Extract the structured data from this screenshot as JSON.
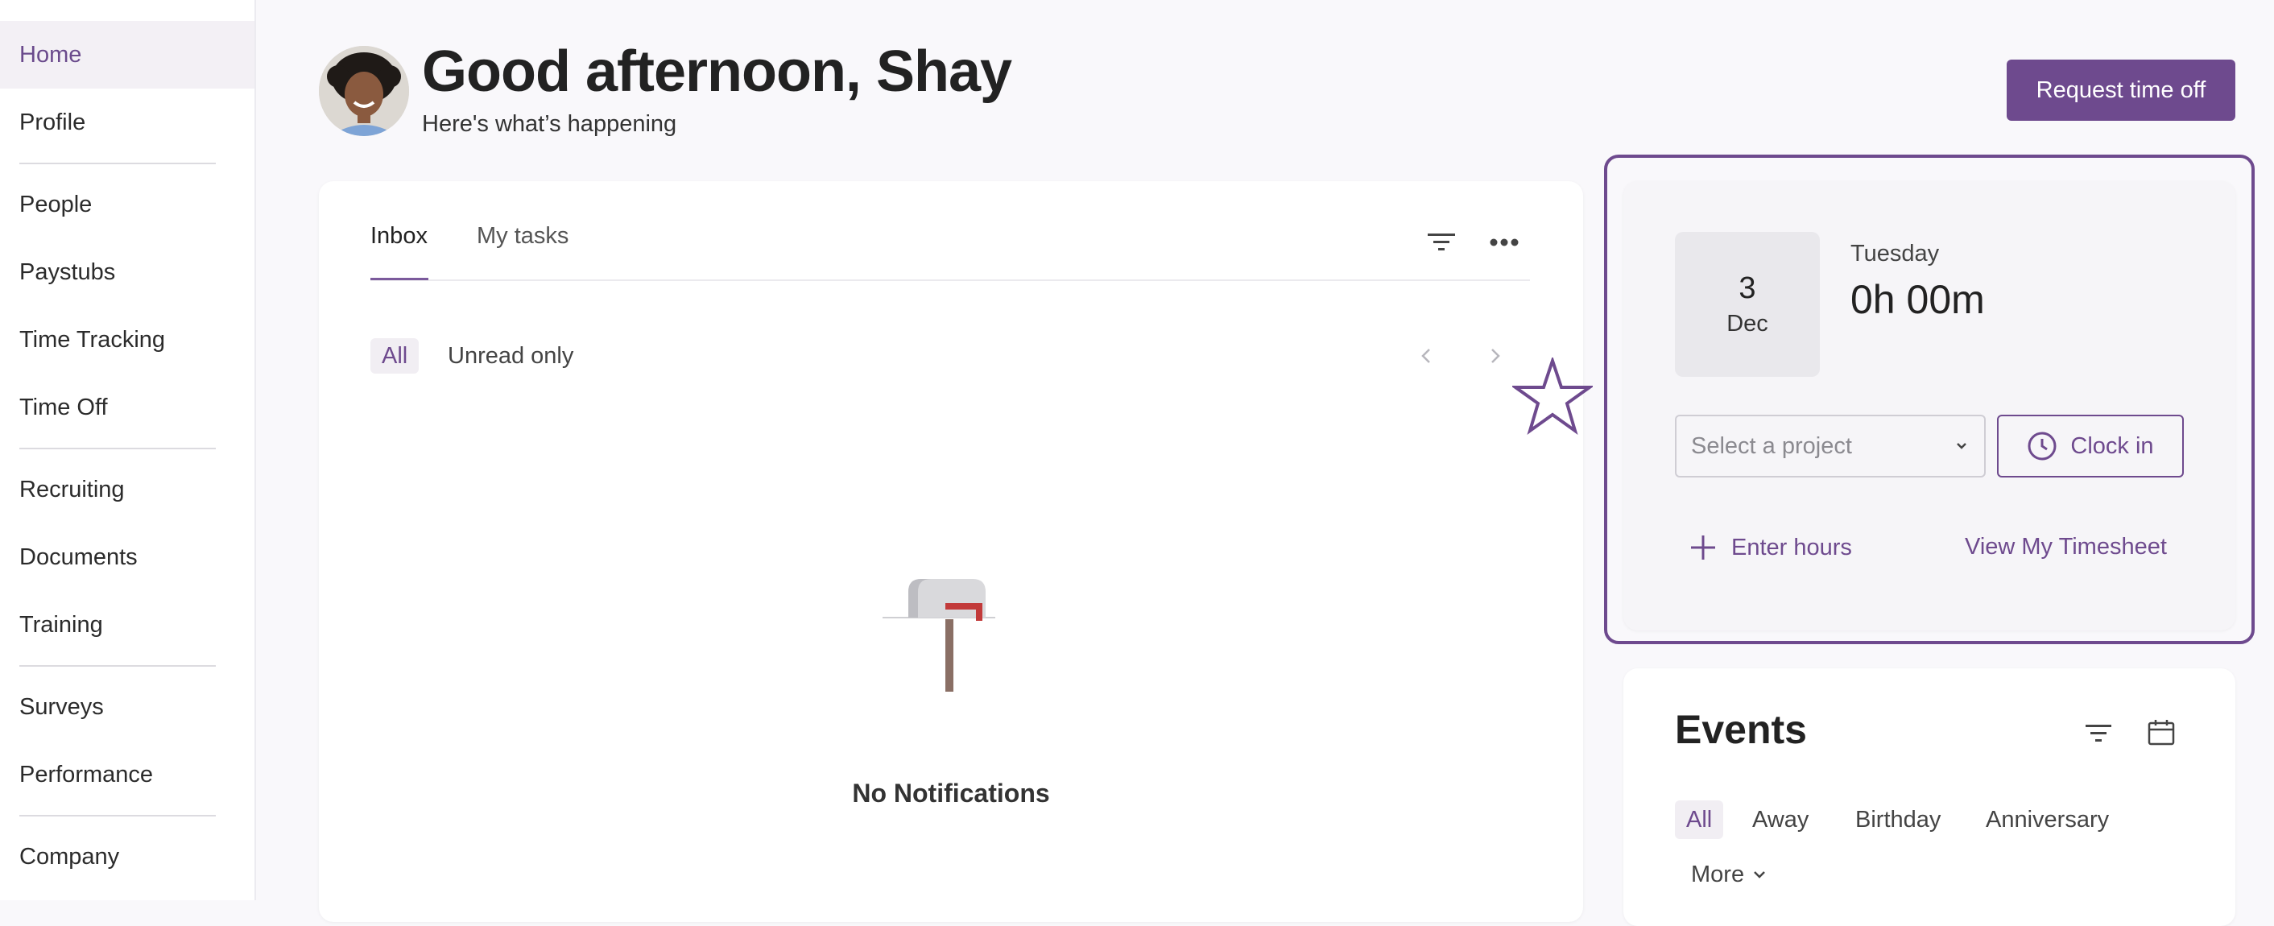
{
  "sidebar": {
    "items": [
      {
        "label": "Home",
        "active": true
      },
      {
        "label": "Profile"
      },
      {
        "label": "People"
      },
      {
        "label": "Paystubs"
      },
      {
        "label": "Time Tracking"
      },
      {
        "label": "Time Off"
      },
      {
        "label": "Recruiting"
      },
      {
        "label": "Documents"
      },
      {
        "label": "Training"
      },
      {
        "label": "Surveys"
      },
      {
        "label": "Performance"
      },
      {
        "label": "Company"
      }
    ]
  },
  "header": {
    "greeting": "Good afternoon, Shay",
    "subtitle": "Here's what’s happening",
    "request_button": "Request time off"
  },
  "inbox": {
    "tabs": [
      "Inbox",
      "My tasks"
    ],
    "filters": [
      "All",
      "Unread only"
    ],
    "empty_message": "No Notifications"
  },
  "time": {
    "day": "3",
    "month": "Dec",
    "weekday": "Tuesday",
    "hours": "0h 00m",
    "project_placeholder": "Select a project",
    "clock_in": "Clock in",
    "enter_hours": "Enter hours",
    "view_timesheet": "View My Timesheet"
  },
  "events": {
    "title": "Events",
    "filters": [
      "All",
      "Away",
      "Birthday",
      "Anniversary"
    ],
    "more": "More"
  },
  "colors": {
    "accent": "#6e4a8e",
    "background": "#f9f8fb"
  }
}
